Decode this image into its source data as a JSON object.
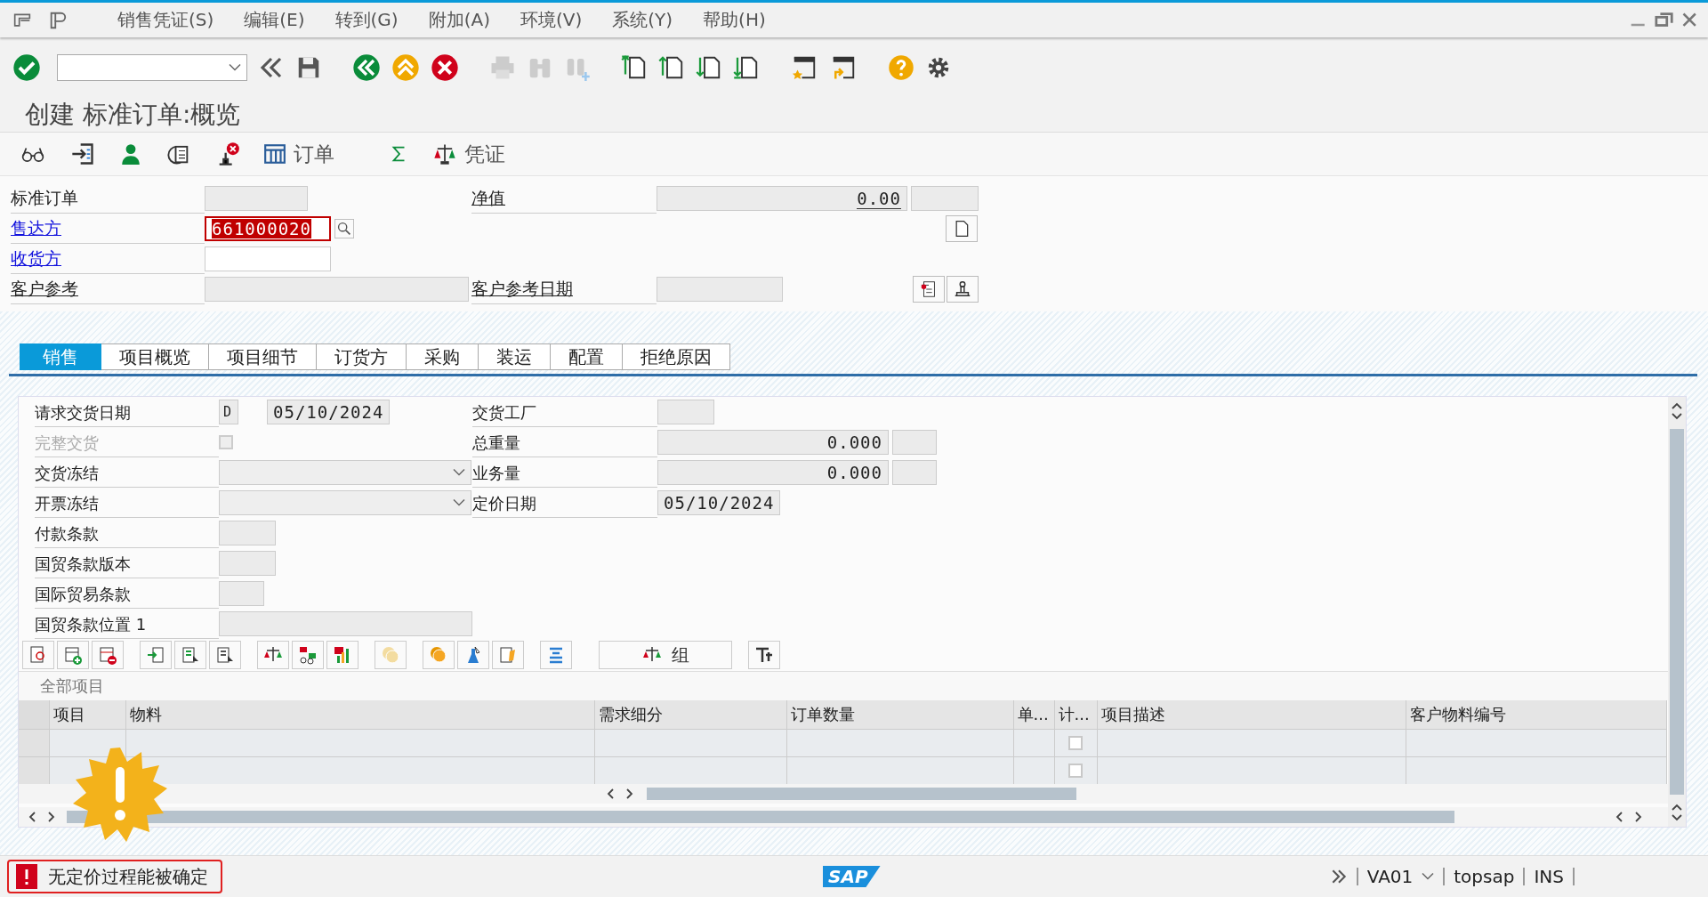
{
  "menu": [
    "销售凭证(S)",
    "编辑(E)",
    "转到(G)",
    "附加(A)",
    "环境(V)",
    "系统(Y)",
    "帮助(H)"
  ],
  "title": "创建 标准订单:概览",
  "app_toolbar": {
    "order_button": "订单",
    "document_button": "凭证"
  },
  "header": {
    "rows": [
      {
        "label": {
          "text": "标准订单",
          "link": false
        },
        "field": {
          "kind": "readonly"
        },
        "right": {
          "label": "净值",
          "value": "0.00"
        }
      },
      {
        "label": {
          "text": "售达方",
          "link": true
        },
        "field": {
          "kind": "input",
          "value": "661000020",
          "error": true
        }
      },
      {
        "label": {
          "text": "收货方",
          "link": true
        },
        "field": {
          "kind": "input",
          "error": false
        }
      },
      {
        "label": {
          "text": "客户参考",
          "link": false
        },
        "field": {
          "kind": "wide"
        },
        "right": {
          "label": "客户参考日期"
        }
      }
    ]
  },
  "tabs": [
    {
      "label": "销售",
      "selected": true
    },
    {
      "label": "项目概览",
      "selected": false
    },
    {
      "label": "项目细节",
      "selected": false
    },
    {
      "label": "订货方",
      "selected": false
    },
    {
      "label": "采购",
      "selected": false
    },
    {
      "label": "装运",
      "selected": false
    },
    {
      "label": "配置",
      "selected": false
    },
    {
      "label": "拒绝原因",
      "selected": false
    }
  ],
  "sales": {
    "left": [
      {
        "label": "请求交货日期",
        "kind": "date",
        "prefix": "D",
        "value": "05/10/2024",
        "disabled": false
      },
      {
        "label": "完整交货",
        "kind": "checkbox",
        "checked": false,
        "disabled": true
      },
      {
        "label": "交货冻结",
        "kind": "dropdown",
        "disabled": false
      },
      {
        "label": "开票冻结",
        "kind": "dropdown",
        "disabled": false
      },
      {
        "label": "付款条款",
        "kind": "short",
        "disabled": false
      },
      {
        "label": "国贸条款版本",
        "kind": "short",
        "disabled": false
      },
      {
        "label": "国际贸易条款",
        "kind": "tiny",
        "disabled": false
      },
      {
        "label": "国贸条款位置 1",
        "kind": "long",
        "disabled": false
      }
    ],
    "right": [
      {
        "label": "交货工厂",
        "kind": "short"
      },
      {
        "label": "总重量",
        "kind": "number",
        "value": "0.000"
      },
      {
        "label": "业务量",
        "kind": "number",
        "value": "0.000"
      },
      {
        "label": "定价日期",
        "kind": "date",
        "value": "05/10/2024"
      }
    ]
  },
  "item_toolbar": {
    "group_button": "组"
  },
  "items": {
    "title": "全部项目",
    "columns": [
      "项目",
      "物料",
      "需求细分",
      "订单数量",
      "单...",
      "计...",
      "项目描述",
      "客户物料编号"
    ],
    "rows": [
      {
        "checked": false
      },
      {
        "checked": false
      }
    ]
  },
  "status_bar": {
    "message": {
      "text": "无定价过程能被确定"
    },
    "logo": "SAP",
    "transaction": "VA01",
    "system": "topsap",
    "mode": "INS"
  }
}
